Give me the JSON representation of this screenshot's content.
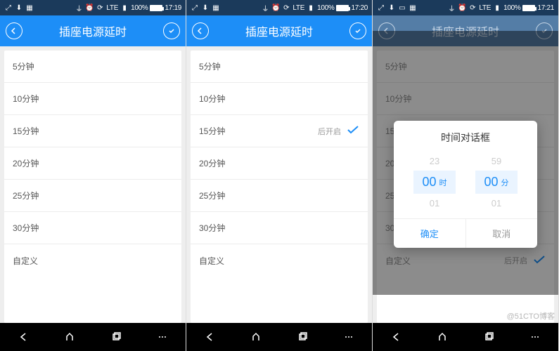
{
  "status": {
    "net_label": "LTE",
    "battery": "100%",
    "times": [
      "17:19",
      "17:20",
      "17:21"
    ]
  },
  "header": {
    "title": "插座电源延时"
  },
  "list": {
    "items": [
      "5分钟",
      "10分钟",
      "15分钟",
      "20分钟",
      "25分钟",
      "30分钟",
      "自定义"
    ],
    "selected_tail": "后开启"
  },
  "dialog": {
    "title": "时间对话框",
    "hour_prev": "23",
    "hour_sel": "00",
    "hour_next": "01",
    "hour_unit": "时",
    "min_prev": "59",
    "min_sel": "00",
    "min_next": "01",
    "min_unit": "分",
    "ok": "确定",
    "cancel": "取消"
  },
  "watermark": "@51CTO博客"
}
